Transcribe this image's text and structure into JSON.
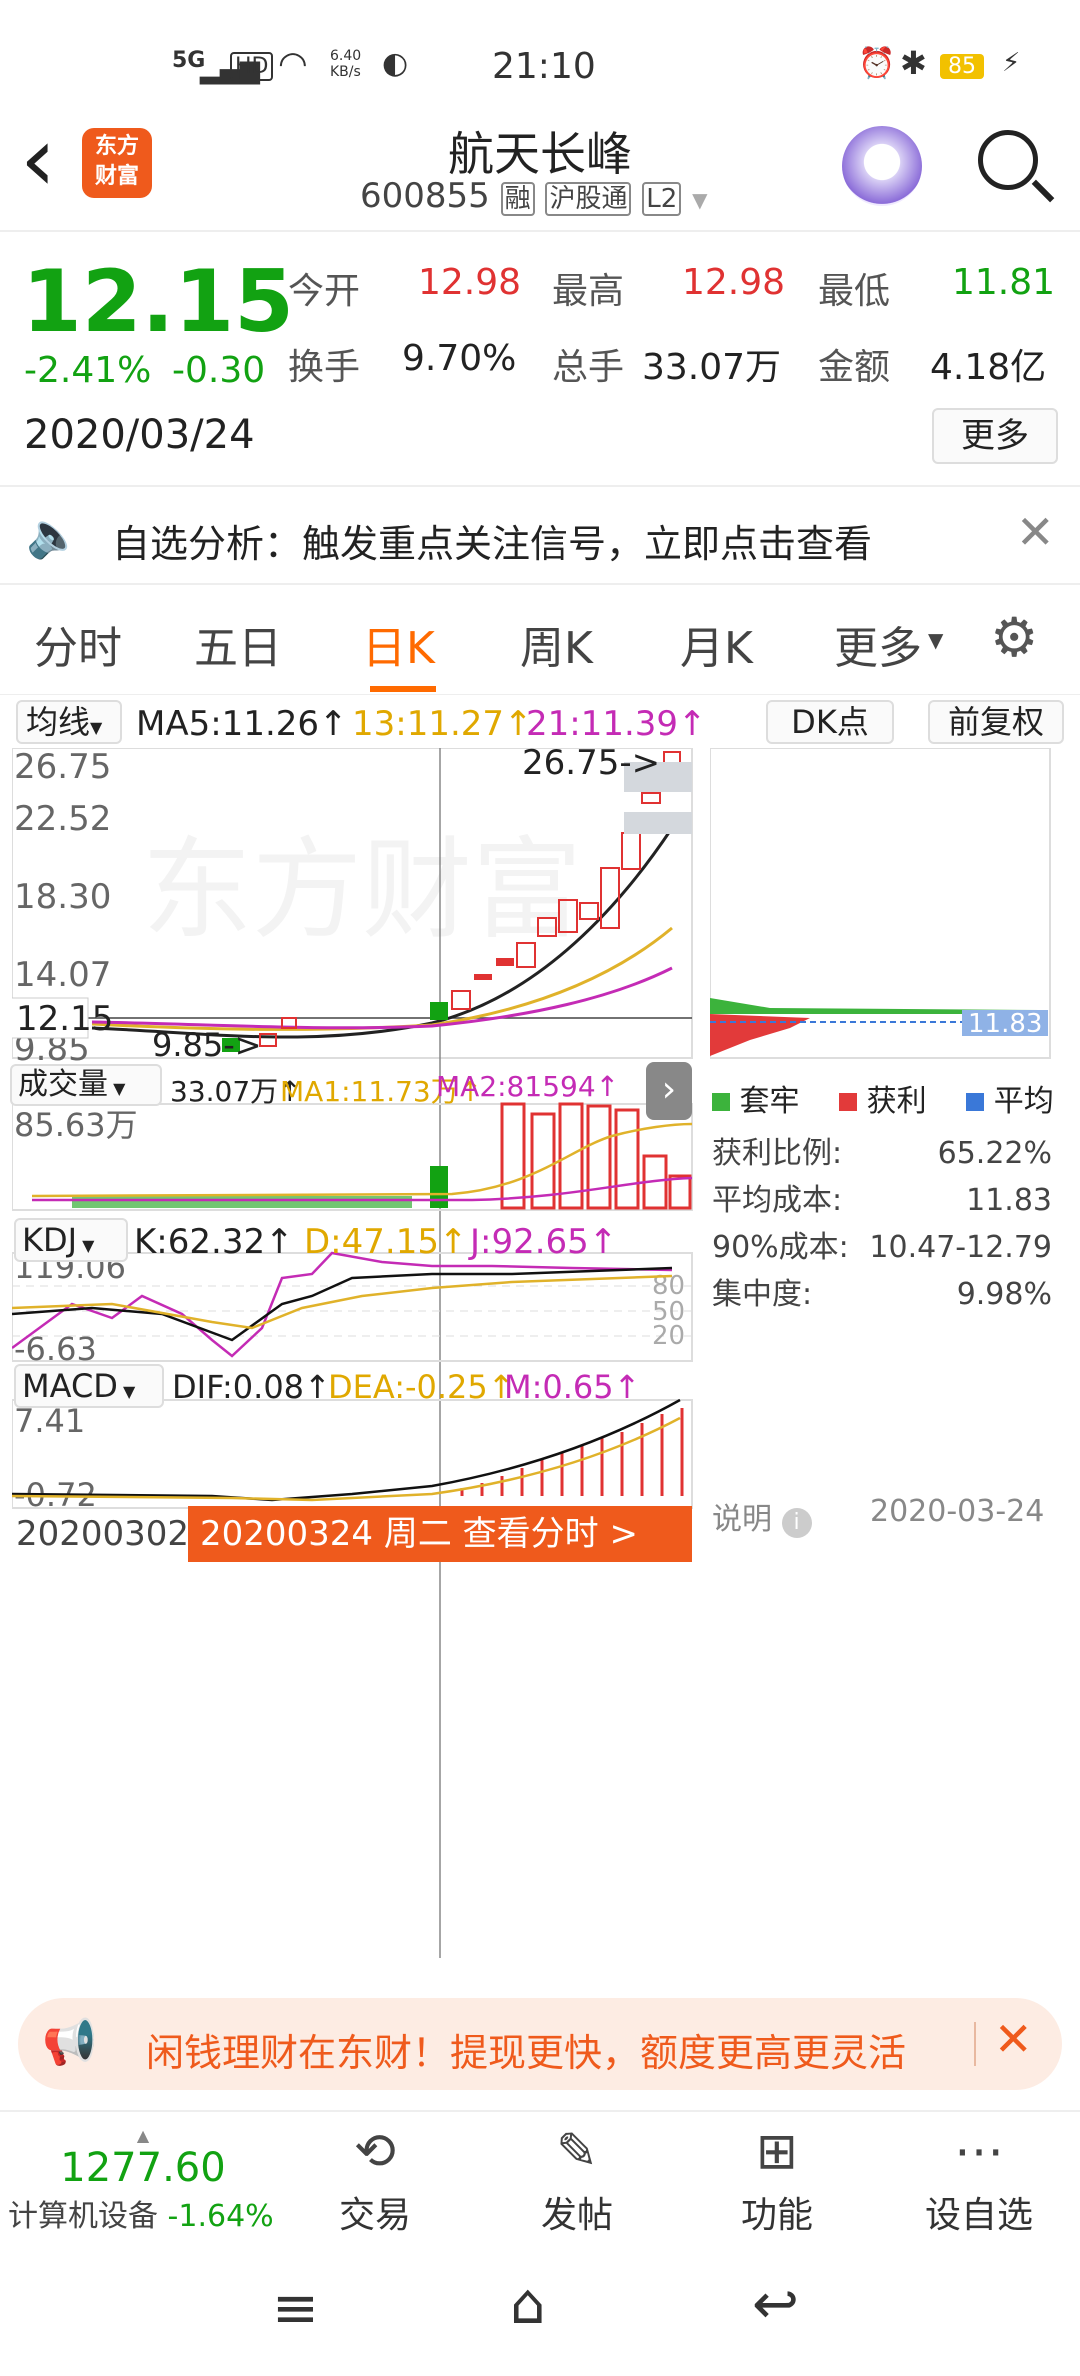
{
  "status": {
    "net": "5G",
    "hd": "HD",
    "speed": "6.40\nKB/s",
    "time": "21:10",
    "battery": "85"
  },
  "header": {
    "back": "‹",
    "logo": "东方\n财富",
    "name": "航天长峰",
    "code": "600855",
    "tags": [
      "融",
      "沪股通",
      "L2"
    ]
  },
  "quote": {
    "price": "12.15",
    "pct": "-2.41%",
    "chg": "-0.30",
    "date": "2020/03/24",
    "open_label": "今开",
    "open": "12.98",
    "high_label": "最高",
    "high": "12.98",
    "low_label": "最低",
    "low": "11.81",
    "turn_label": "换手",
    "turn": "9.70%",
    "vol_label": "总手",
    "vol": "33.07万",
    "amt_label": "金额",
    "amt": "4.18亿",
    "more": "更多"
  },
  "banner": {
    "text": "自选分析：触发重点关注信号，立即点击查看"
  },
  "tabs": [
    "分时",
    "五日",
    "日K",
    "周K",
    "月K",
    "更多",
    "⚙"
  ],
  "kline": {
    "ma_btn": "均线",
    "ma5": "MA5:11.26↑",
    "ma13": "13:11.27↑",
    "ma21": "21:11.39↑",
    "dk": "DK点",
    "fq": "前复权",
    "y1": "26.75",
    "y2": "22.52",
    "y3": "18.30",
    "y4": "14.07",
    "y5": "9.85",
    "cur": "12.15",
    "hi_lbl": "26.75->",
    "lo_lbl": "9.85->",
    "watermark": "东方财富"
  },
  "vol": {
    "btn": "成交量",
    "v": "33.07万↑",
    "ma1": "MA1:11.73万↑",
    "ma2": "MA2:81594↑",
    "ymax": "85.63万"
  },
  "kdj": {
    "btn": "KDJ",
    "k": "K:62.32↑",
    "d": "D:47.15↑",
    "j": "J:92.65↑",
    "ymax": "119.06",
    "ymin": "-6.63",
    "l80": "80",
    "l50": "50",
    "l20": "20"
  },
  "macd": {
    "btn": "MACD",
    "dif": "DIF:0.08↑",
    "dea": "DEA:-0.25↑",
    "m": "M:0.65↑",
    "ymax": "7.41",
    "ymin": "-0.72"
  },
  "dates": {
    "start": "20200302",
    "sel": "20200324 周二 查看分时 >"
  },
  "chips": {
    "cost_tag": "11.83",
    "legend": [
      "套牢",
      "获利",
      "平均"
    ],
    "rows": [
      [
        "获利比例:",
        "65.22%"
      ],
      [
        "平均成本:",
        "11.83"
      ],
      [
        "90%成本:",
        "10.47-12.79"
      ],
      [
        "集中度:",
        "9.98%"
      ]
    ],
    "note": "说明",
    "date": "2020-03-24"
  },
  "ad": {
    "text": "闲钱理财在东财！提现更快，额度更高更灵活"
  },
  "dock": {
    "index_val": "1277.60",
    "index_name": "计算机设备",
    "index_pct": "-1.64%",
    "items": [
      "交易",
      "发帖",
      "功能",
      "设自选"
    ]
  },
  "colors": {
    "up": "#e03232",
    "down": "#12a212",
    "accent": "#ff6a00"
  }
}
